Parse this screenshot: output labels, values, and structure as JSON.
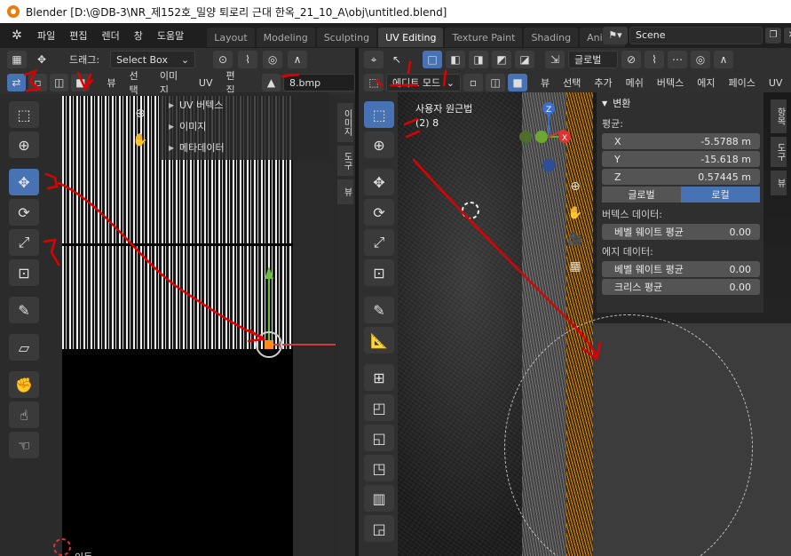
{
  "window": {
    "title": "Blender [D:\\@DB-3\\NR_제152호_밀양 퇴로리 근대 한옥_21_10_A\\obj\\untitled.blend]"
  },
  "topmenu": {
    "items": [
      "파일",
      "편집",
      "렌더",
      "창",
      "도움말"
    ],
    "tabs": [
      {
        "label": "Layout",
        "active": false
      },
      {
        "label": "Modeling",
        "active": false
      },
      {
        "label": "Sculpting",
        "active": false
      },
      {
        "label": "UV Editing",
        "active": true
      },
      {
        "label": "Texture Paint",
        "active": false
      },
      {
        "label": "Shading",
        "active": false
      },
      {
        "label": "Anima",
        "active": false
      }
    ],
    "scene_label": "Scene"
  },
  "uv_editor": {
    "drag_label": "드래그:",
    "select_mode": "Select Box",
    "menus": [
      "뷰",
      "선택",
      "이미지",
      "UV",
      "편집"
    ],
    "image_name": "8.bmp",
    "overlay": [
      "UV 버텍스",
      "이미지",
      "메타데이터"
    ],
    "side_tabs": [
      "이미지",
      "도구",
      "뷰"
    ],
    "bottom_label": "이동"
  },
  "viewport": {
    "mode": "에디트 모드",
    "menus": [
      "뷰",
      "선택",
      "추가",
      "메쉬",
      "버텍스",
      "에지",
      "페이스",
      "UV"
    ],
    "orientation": "글로벌",
    "view_label": "사용자 원근법",
    "object_label": "(2) 8",
    "side_tabs": [
      "항목",
      "도구",
      "뷰"
    ]
  },
  "npanel": {
    "title": "변환",
    "median_label": "평균:",
    "fields": [
      {
        "axis": "X",
        "value": "-5.5788 m"
      },
      {
        "axis": "Y",
        "value": "-15.618 m"
      },
      {
        "axis": "Z",
        "value": "0.57445 m"
      }
    ],
    "space": {
      "global": "글로벌",
      "local": "로컬"
    },
    "vertex_data": "버텍스 데이터:",
    "vertex_bevel": {
      "label": "베벨 웨이트 평균",
      "value": "0.00"
    },
    "edge_data": "에지 데이터:",
    "edge_bevel": {
      "label": "베벨 웨이트 평균",
      "value": "0.00"
    },
    "edge_crease": {
      "label": "크리스 평균",
      "value": "0.00"
    }
  },
  "annotation_color": "#e00000",
  "accent": "#4772b3"
}
